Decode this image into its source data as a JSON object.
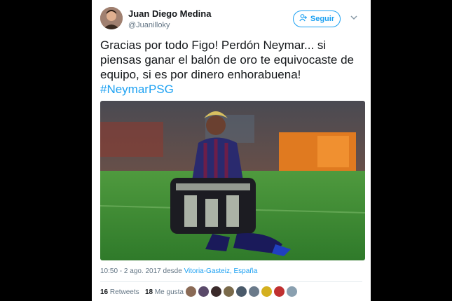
{
  "user": {
    "name": "Juan Diego Medina",
    "handle": "@Juanilloky"
  },
  "follow_label": "Seguir",
  "tweet": {
    "text": "Gracias por todo Figo! Perdón Neymar... si piensas ganar el balón de oro te equivocaste de equipo, si es por dinero enhorabuena!",
    "hashtag": "#NeymarPSG"
  },
  "meta": {
    "time": "10:50 - 2 ago. 2017",
    "from": "desde",
    "location": "Vitoria-Gasteiz, España"
  },
  "stats": {
    "retweets_count": "16",
    "retweets_label": "Retweets",
    "likes_count": "18",
    "likes_label": "Me gusta"
  },
  "colors": {
    "accent": "#1da1f2",
    "text": "#14171a",
    "muted": "#657786",
    "pitch": "#3d8a33",
    "kit": "#2a2a6e"
  },
  "icons": [
    "add-user-icon",
    "chevron-down-icon"
  ],
  "liker_colors": [
    "#8a6a55",
    "#5a4a6a",
    "#3a2a2a",
    "#7a6a4a",
    "#4a5a6a",
    "#6a7a8a",
    "#d4b020",
    "#c03030",
    "#8aa0b0"
  ]
}
